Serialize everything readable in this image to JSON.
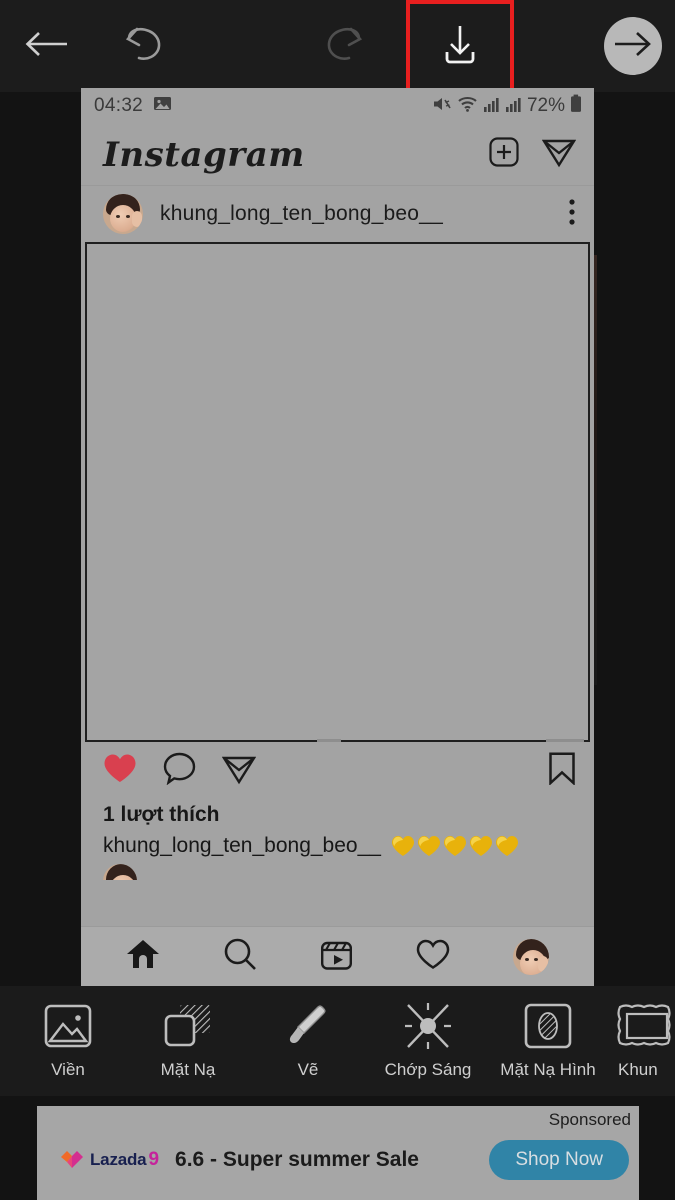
{
  "editor": {
    "toolbar": {
      "back_icon": "back-arrow-icon",
      "undo_icon": "undo-icon",
      "redo_icon": "redo-icon",
      "save_icon": "download-icon",
      "next_icon": "forward-arrow-icon",
      "highlight_color": "#e81f1f",
      "highlighted_button": "download-button"
    },
    "tools": [
      {
        "label": "Viền",
        "icon": "picture-frame-icon"
      },
      {
        "label": "Mặt Nạ",
        "icon": "mask-squares-icon"
      },
      {
        "label": "Vẽ",
        "icon": "paintbrush-icon"
      },
      {
        "label": "Chớp Sáng",
        "icon": "lens-flare-icon"
      },
      {
        "label": "Mặt Nạ Hình",
        "icon": "shape-mask-icon"
      },
      {
        "label": "Khun",
        "icon": "wavy-frame-icon"
      }
    ]
  },
  "preview": {
    "status_bar": {
      "time": "04:32",
      "gallery_icon": "image-icon",
      "mute_icon": "mute-icon",
      "wifi_icon": "wifi-icon",
      "signal_icon_1": "signal-bars-icon",
      "signal_icon_2": "signal-bars-icon",
      "battery_pct": "72%",
      "battery_icon": "battery-icon"
    },
    "app_header": {
      "logo_text": "Instagram",
      "add_icon": "plus-square-icon",
      "messages_icon": "send-paper-plane-icon"
    },
    "post": {
      "username": "khung_long_ten_bong_beo__",
      "avatar": "user-avatar",
      "more_icon": "more-options-icon",
      "media": "post-photo",
      "actions": {
        "like_icon": "heart-filled-icon",
        "like_color": "#d9404f",
        "comment_icon": "comment-bubble-icon",
        "share_icon": "send-paper-plane-icon",
        "bookmark_icon": "bookmark-icon"
      },
      "likes_text": "1 lượt thích",
      "caption_user": "khung_long_ten_bong_beo__",
      "caption_emoji_count": 5,
      "caption_emoji": "yellow-heart",
      "emoji_color": "#e8b20b"
    },
    "bottom_nav": [
      {
        "icon": "home-icon",
        "active": true
      },
      {
        "icon": "search-icon",
        "active": false
      },
      {
        "icon": "reels-icon",
        "active": false
      },
      {
        "icon": "activity-heart-icon",
        "active": false
      },
      {
        "icon": "profile-avatar-icon",
        "active": false
      }
    ]
  },
  "ad": {
    "sponsored_label": "Sponsored",
    "brand_name": "Lazada",
    "brand_mark": "9",
    "headline": "6.6 - Super summer Sale",
    "cta_label": "Shop Now",
    "cta_color": "#3084a7"
  }
}
